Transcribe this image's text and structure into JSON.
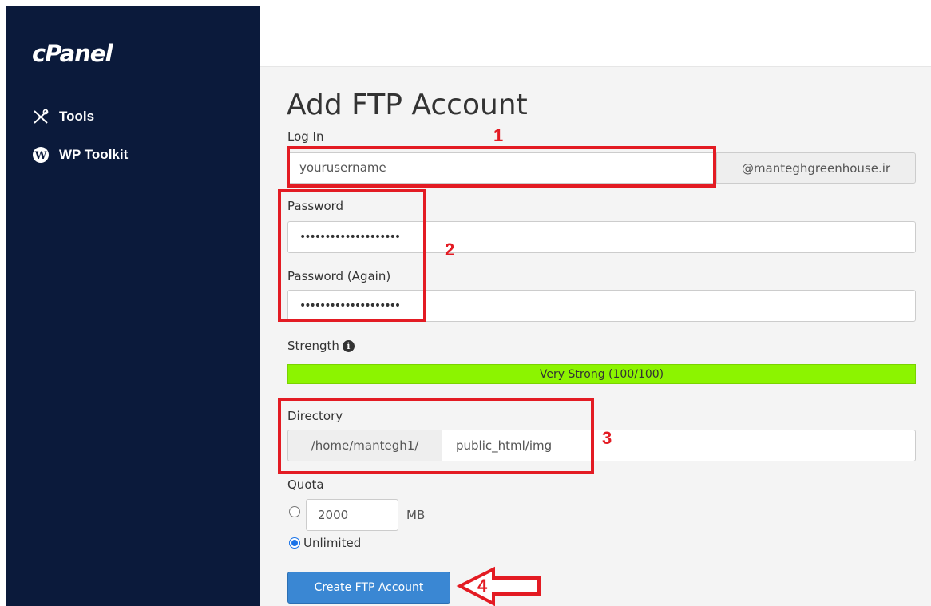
{
  "sidebar": {
    "logo": "cPanel",
    "items": [
      {
        "label": "Tools",
        "icon": "tools-icon"
      },
      {
        "label": "WP Toolkit",
        "icon": "wordpress-icon"
      }
    ]
  },
  "page": {
    "title": "Add FTP Account"
  },
  "form": {
    "login": {
      "label": "Log In",
      "value": "yourusername",
      "domain": "@manteghgreenhouse.ir"
    },
    "password": {
      "label": "Password",
      "value": "••••••••••••••••••••"
    },
    "password_again": {
      "label": "Password (Again)",
      "value": "••••••••••••••••••••"
    },
    "strength": {
      "label": "Strength",
      "meter_text": "Very Strong (100/100)",
      "level": 100
    },
    "directory": {
      "label": "Directory",
      "prefix": "/home/mantegh1/",
      "value": "public_html/img"
    },
    "quota": {
      "label": "Quota",
      "value": "2000",
      "unit": "MB",
      "unlimited_label": "Unlimited",
      "selected": "unlimited"
    },
    "submit_label": "Create FTP Account"
  },
  "annotations": {
    "n1": "1",
    "n2": "2",
    "n3": "3",
    "n4": "4"
  },
  "colors": {
    "sidebar": "#0b1a3b",
    "accent": "#3a87d3",
    "strength": "#8cf400",
    "annotation": "#e31b23"
  }
}
